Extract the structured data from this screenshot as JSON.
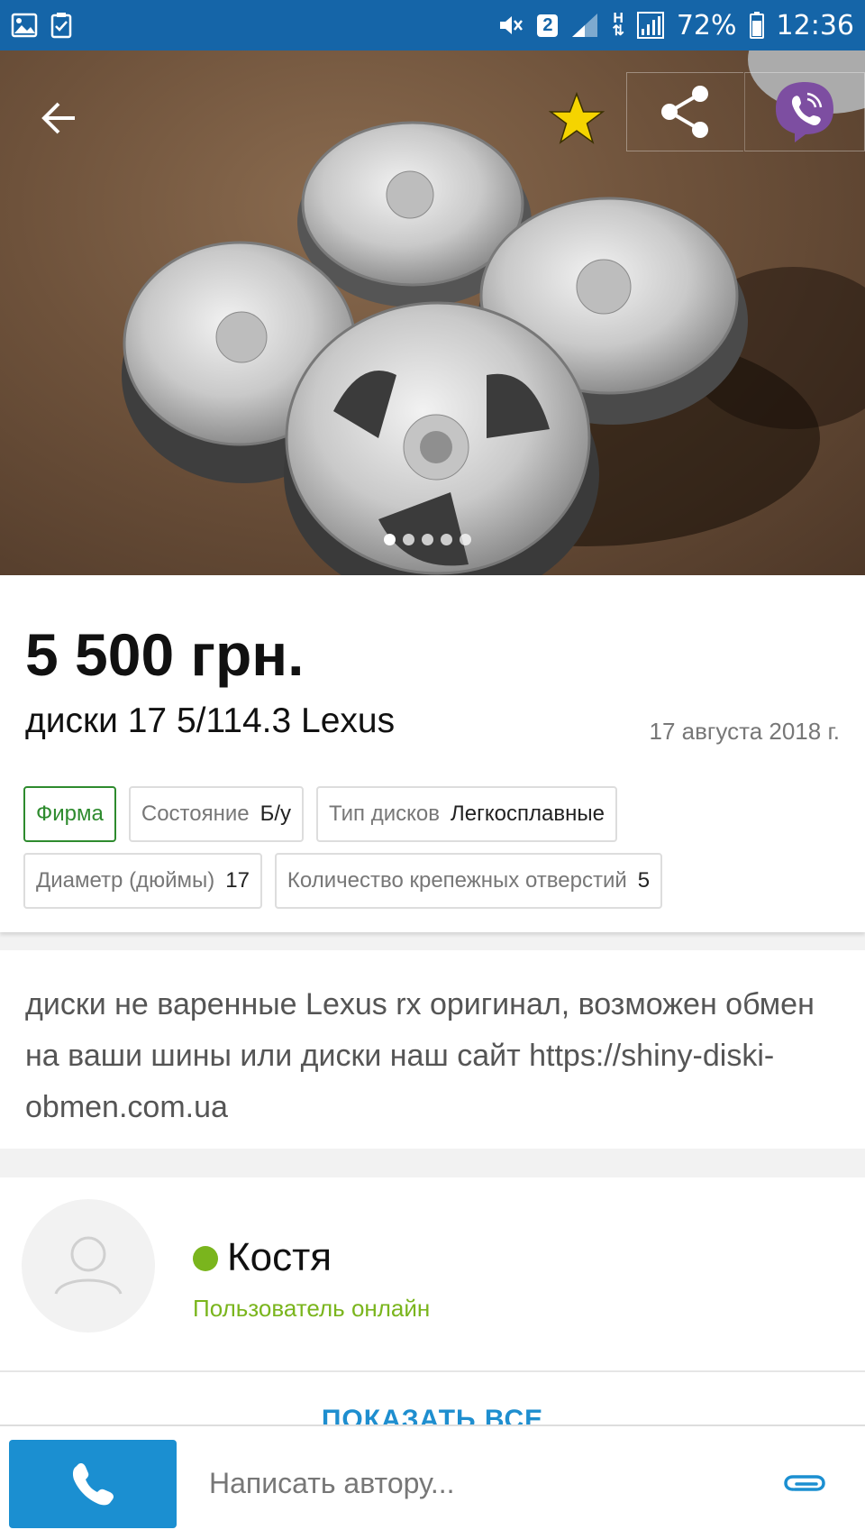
{
  "status_bar": {
    "left_icons": [
      "image-icon",
      "task-icon"
    ],
    "sim_badge": "2",
    "network_label": "H",
    "battery": "72%",
    "time": "12:36"
  },
  "gallery": {
    "photo_count": 5,
    "active_index": 0,
    "favorite_color": "#f5d400",
    "viber_color": "#7d4ea1"
  },
  "listing": {
    "price": "5 500 грн.",
    "title": "диски 17 5/114.3 Lexus",
    "date": "17 августа 2018 г."
  },
  "tags": {
    "firma": "Фирма",
    "condition": {
      "label": "Состояние",
      "value": "Б/у"
    },
    "wheel_type": {
      "label": "Тип дисков",
      "value": "Легкосплавные"
    },
    "diameter": {
      "label": "Диаметр (дюймы)",
      "value": "17"
    },
    "bolt_holes": {
      "label": "Количество крепежных отверстий",
      "value": "5"
    }
  },
  "description": "диски не варенные Lexus rx оригинал,   возможен обмен на ваши шины или диски наш сайт https://shiny-diski-obmen.com.ua",
  "seller": {
    "name": "Костя",
    "status": "Пользователь онлайн",
    "show_all": "ПОКАЗАТЬ ВСЕ"
  },
  "bottom": {
    "message_placeholder": "Написать автору..."
  },
  "colors": {
    "accent": "#1b8fd1",
    "status_bar": "#1565a8",
    "online": "#7ab51d",
    "firma": "#2e8b2e"
  }
}
